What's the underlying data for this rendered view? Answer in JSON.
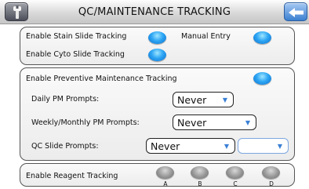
{
  "header": {
    "title": "QC/MAINTENANCE TRACKING",
    "settings_icon": "tool-icon",
    "back_icon": "back-arrow-icon"
  },
  "slide_tracking": {
    "stain_label": "Enable Stain Slide Tracking",
    "stain_enabled": true,
    "manual_entry_label": "Manual Entry",
    "manual_entry_enabled": true,
    "cyto_label": "Enable Cyto Slide Tracking",
    "cyto_enabled": true
  },
  "pm_tracking": {
    "enable_label": "Enable Preventive Maintenance Tracking",
    "enabled": true,
    "daily_label": "Daily PM Prompts:",
    "daily_value": "Never",
    "weekly_label": "Weekly/Monthly PM Prompts:",
    "weekly_value": "Never",
    "qc_label": "QC Slide Prompts:",
    "qc_value": "Never",
    "qc_secondary_value": ""
  },
  "reagent_tracking": {
    "label": "Enable Reagent Tracking",
    "slots": [
      {
        "letter": "A",
        "enabled": false
      },
      {
        "letter": "B",
        "enabled": false
      },
      {
        "letter": "C",
        "enabled": false
      },
      {
        "letter": "D",
        "enabled": false
      }
    ]
  },
  "colors": {
    "toggle_on": "#2ea6f4",
    "toggle_off": "#9b9b9b",
    "dropdown_arrow": "#3a7fd6",
    "back_button": "#3b7fd0"
  }
}
